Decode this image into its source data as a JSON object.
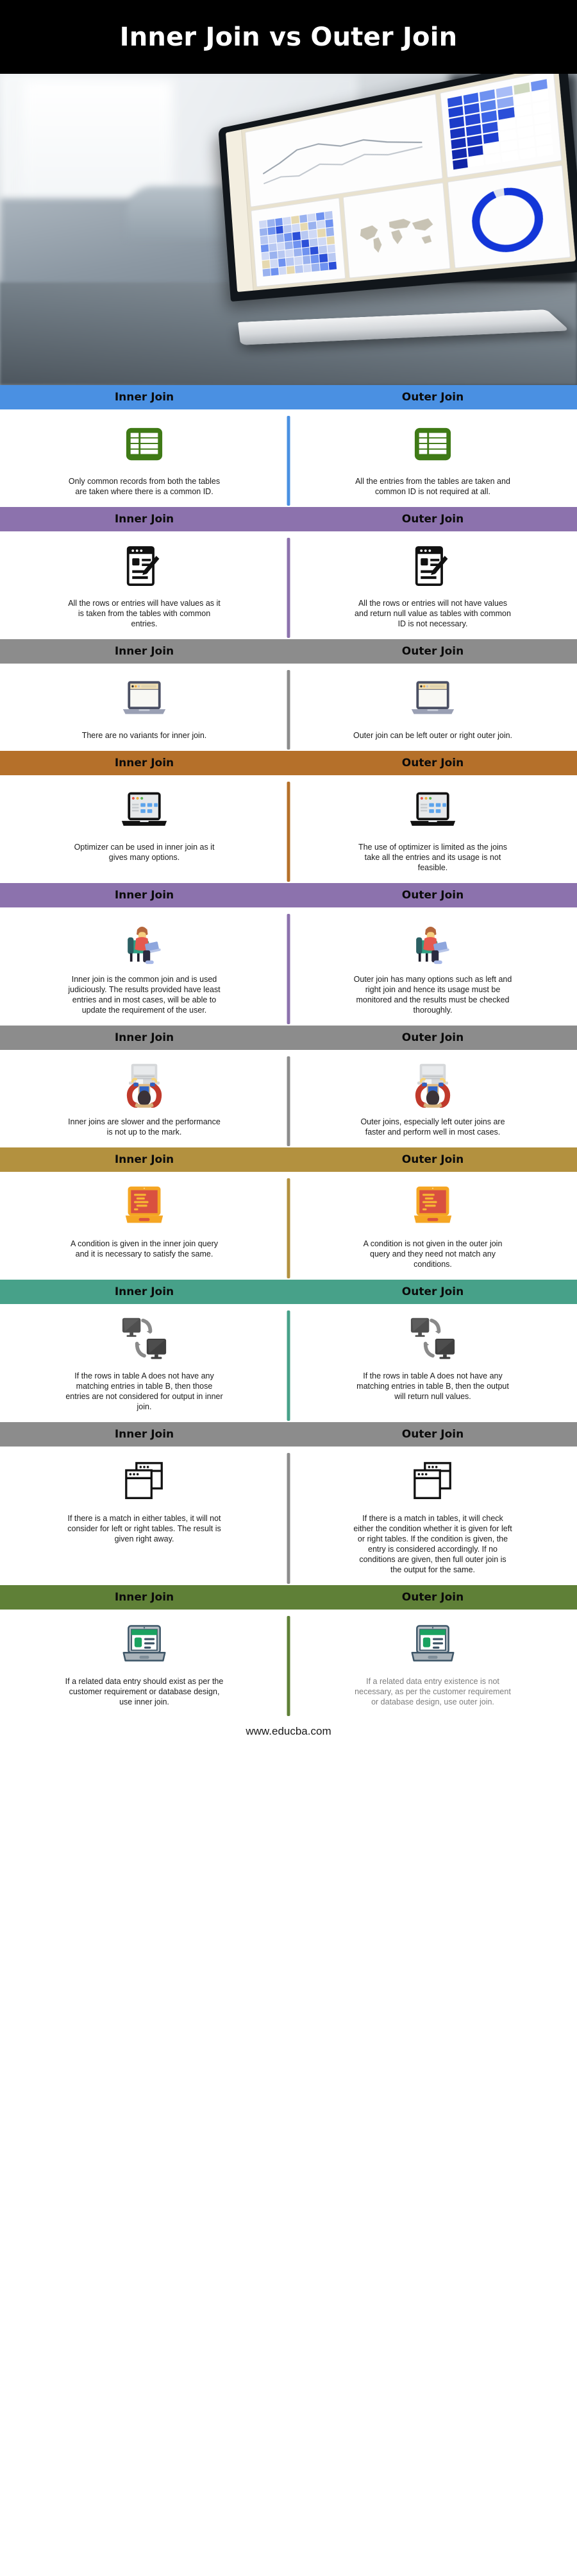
{
  "title": "Inner Join vs Outer Join",
  "hero": {
    "alt": "laptop-dashboard-photo"
  },
  "column_labels": {
    "left": "Inner Join",
    "right": "Outer Join"
  },
  "footer": {
    "url": "www.educba.com"
  },
  "colors": {
    "title_bg": "#000000",
    "section_1": "#4a90e2",
    "section_2": "#8c72ad",
    "section_3": "#8c8c8c",
    "section_4": "#b5702a",
    "section_5": "#8c72ad",
    "section_6": "#8c8c8c",
    "section_7": "#b3913f",
    "section_8": "#47a189",
    "section_9": "#8c8c8c",
    "section_10": "#5f8037"
  },
  "sections": [
    {
      "id": "common-records",
      "color": "#4a90e2",
      "header_left": "Inner Join",
      "header_right": "Outer Join",
      "icon": "table-grid-icon",
      "left_text": "Only common records from both the tables are taken where there is a common ID.",
      "right_text": "All the entries from the tables are taken and common ID is not required at all."
    },
    {
      "id": "row-values",
      "color": "#8c72ad",
      "header_left": "Inner Join",
      "header_right": "Outer Join",
      "icon": "document-pencil-icon",
      "left_text": "All the rows or entries will have values as it is taken from the tables with common entries.",
      "right_text": "All the rows or entries will not have values and return null value as tables with common ID is not necessary."
    },
    {
      "id": "variants",
      "color": "#8c8c8c",
      "header_left": "Inner Join",
      "header_right": "Outer Join",
      "icon": "laptop-browser-icon",
      "left_text": "There are no variants for inner join.",
      "right_text": "Outer join can be left outer or right outer join."
    },
    {
      "id": "optimizer",
      "color": "#b5702a",
      "header_left": "Inner Join",
      "header_right": "Outer Join",
      "icon": "laptop-dashboard-icon",
      "left_text": "Optimizer can be used in inner join as it gives many options.",
      "right_text": "The use of optimizer is limited as the joins take all the entries and its usage is not feasible."
    },
    {
      "id": "usage",
      "color": "#8c72ad",
      "header_left": "Inner Join",
      "header_right": "Outer Join",
      "icon": "person-at-desk-icon",
      "left_text": "Inner join is the common join and is used judiciously. The results provided have least entries and in most cases, will be able to update the requirement of the user.",
      "right_text": "Outer join has many options such as left and right join and hence its usage must be monitored and the results must be checked thoroughly."
    },
    {
      "id": "performance",
      "color": "#8c8c8c",
      "header_left": "Inner Join",
      "header_right": "Outer Join",
      "icon": "person-celebrating-icon",
      "left_text": "Inner joins are slower and the performance is not up to the mark.",
      "right_text": "Outer joins, especially left outer joins are faster and perform well in most cases."
    },
    {
      "id": "conditions",
      "color": "#b3913f",
      "header_left": "Inner Join",
      "header_right": "Outer Join",
      "icon": "code-monitor-icon",
      "left_text": "A condition is given in the inner join query and it is necessary to satisfy the same.",
      "right_text": "A condition is not given in the outer join query and they need not match any conditions."
    },
    {
      "id": "matching-entries",
      "color": "#47a189",
      "header_left": "Inner Join",
      "header_right": "Outer Join",
      "icon": "two-monitors-sync-icon",
      "left_text": "If the rows in table A does not have any matching entries in table B, then those entries are not considered for output in inner join.",
      "right_text": "If the rows in table A does not have any matching entries in table B, then the output will return null values."
    },
    {
      "id": "match-in-tables",
      "color": "#8c8c8c",
      "header_left": "Inner Join",
      "header_right": "Outer Join",
      "icon": "stacked-windows-icon",
      "left_text": "If there is a match in either tables, it will not consider for left or right tables. The result is given right away.",
      "right_text": "If there is a match in tables, it will check either the condition whether it is given for left or right tables. If the condition is given, the entry is considered accordingly. If no conditions are given, then full outer join is the output for the same."
    },
    {
      "id": "data-entry-existence",
      "color": "#5f8037",
      "header_left": "Inner Join",
      "header_right": "Outer Join",
      "icon": "laptop-profile-icon",
      "left_text": "If a related data entry should exist as per the customer requirement or database design, use inner join.",
      "right_text": "If a related data entry existence is not necessary, as per the customer requirement or database design, use outer join.",
      "right_muted": true
    }
  ]
}
